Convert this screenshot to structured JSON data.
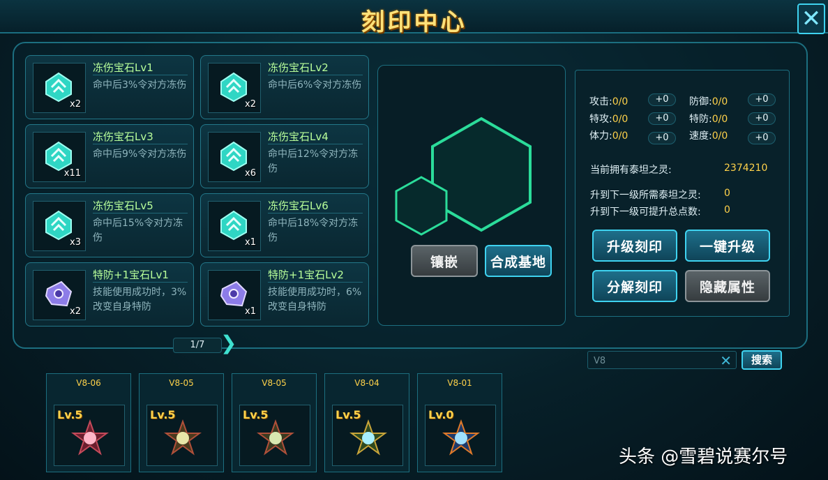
{
  "window": {
    "title": "刻印中心",
    "close_icon": "close-icon"
  },
  "gems": [
    {
      "name": "冻伤宝石Lv1",
      "desc": "命中后3%令对方冻伤",
      "count": "x2",
      "icon": "ice-gem-icon"
    },
    {
      "name": "冻伤宝石Lv2",
      "desc": "命中后6%令对方冻伤",
      "count": "x2",
      "icon": "ice-gem-icon"
    },
    {
      "name": "冻伤宝石Lv3",
      "desc": "命中后9%令对方冻伤",
      "count": "x11",
      "icon": "ice-gem-icon"
    },
    {
      "name": "冻伤宝石Lv4",
      "desc": "命中后12%令对方冻伤",
      "count": "x6",
      "icon": "ice-gem-icon"
    },
    {
      "name": "冻伤宝石Lv5",
      "desc": "命中后15%令对方冻伤",
      "count": "x3",
      "icon": "ice-gem-icon"
    },
    {
      "name": "冻伤宝石Lv6",
      "desc": "命中后18%令对方冻伤",
      "count": "x1",
      "icon": "ice-gem-icon"
    },
    {
      "name": "特防+1宝石Lv1",
      "desc": "技能使用成功时，3%改变自身特防",
      "count": "x2",
      "icon": "purple-gem-icon"
    },
    {
      "name": "特防+1宝石Lv2",
      "desc": "技能使用成功时，6%改变自身特防",
      "count": "x1",
      "icon": "purple-gem-icon"
    }
  ],
  "pager": {
    "text": "1/7"
  },
  "center": {
    "inlay_label": "镶嵌",
    "synth_label": "合成基地"
  },
  "stats": [
    {
      "label": "攻击:",
      "value": "0/0",
      "plus": "+0"
    },
    {
      "label": "防御:",
      "value": "0/0",
      "plus": "+0"
    },
    {
      "label": "特攻:",
      "value": "0/0",
      "plus": "+0"
    },
    {
      "label": "特防:",
      "value": "0/0",
      "plus": "+0"
    },
    {
      "label": "体力:",
      "value": "0/0",
      "plus": "+0"
    },
    {
      "label": "速度:",
      "value": "0/0",
      "plus": "+0"
    }
  ],
  "info": {
    "titan_label": "当前拥有泰坦之灵:",
    "titan_value": "2374210",
    "need_label": "升到下一级所需泰坦之灵:",
    "need_value": "0",
    "points_label": "升到下一级可提升总点数:",
    "points_value": "0"
  },
  "actions": {
    "upgrade": "升级刻印",
    "one_key": "一键升级",
    "decompose": "分解刻印",
    "hide": "隐藏属性"
  },
  "search": {
    "value": "V8",
    "button": "搜索"
  },
  "slots": [
    {
      "code": "V8-06",
      "level": "Lv.5",
      "color": "#ffb6c8"
    },
    {
      "code": "V8-05",
      "level": "Lv.5",
      "color": "#e8e6a8"
    },
    {
      "code": "V8-05",
      "level": "Lv.5",
      "color": "#d8e8b0"
    },
    {
      "code": "V8-04",
      "level": "Lv.5",
      "color": "#a8f0ff"
    },
    {
      "code": "V8-01",
      "level": "Lv.0",
      "color": "#9fe0ff"
    }
  ],
  "watermark": "头条 @雪碧说赛尔号"
}
